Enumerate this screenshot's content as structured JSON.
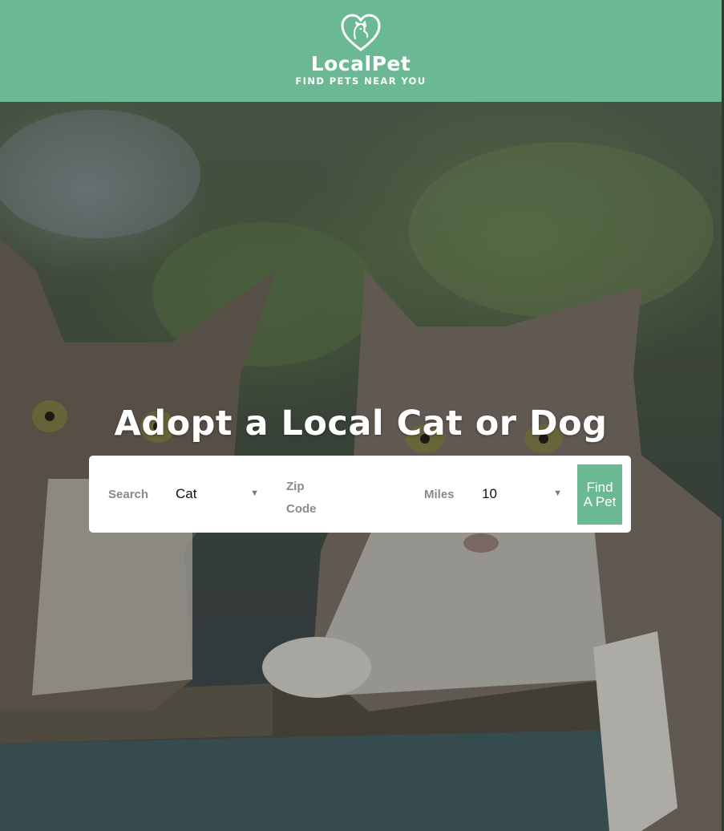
{
  "brand": {
    "name": "LocalPet",
    "tagline": "FIND PETS NEAR YOU",
    "color": "#6ab994"
  },
  "hero": {
    "headline": "Adopt a Local Cat or Dog"
  },
  "search": {
    "search_label": "Search",
    "type_value": "Cat",
    "zip_label": "Zip Code",
    "zip_value": "",
    "miles_label": "Miles",
    "miles_value": "10",
    "button_label": "Find A Pet"
  },
  "icons": {
    "logo": "heart-dog-logo-icon",
    "select_caret": "caret-down-icon"
  }
}
